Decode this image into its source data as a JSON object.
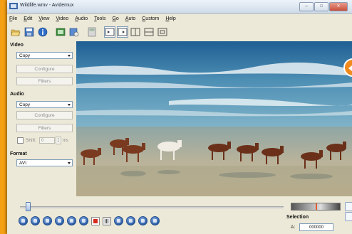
{
  "window": {
    "title": "Wildlife.wmv - Avidemux"
  },
  "menu": [
    "File",
    "Edit",
    "View",
    "Video",
    "Audio",
    "Tools",
    "Go",
    "Auto",
    "Custom",
    "Help"
  ],
  "sidebar": {
    "video": {
      "title": "Video",
      "codec": "Copy",
      "configure_label": "Configure",
      "filters_label": "Filters"
    },
    "audio": {
      "title": "Audio",
      "codec": "Copy",
      "configure_label": "Configure",
      "filters_label": "Filters",
      "shift_label": "Shift:",
      "shift_value": "0",
      "shift_unit": "ms"
    },
    "format": {
      "title": "Format",
      "container": "AVI"
    }
  },
  "selection": {
    "title": "Selection",
    "a_label": "A:",
    "a_value": "000000"
  },
  "playback": {
    "position": 0.03
  },
  "colors": {
    "accent_orange": "#f08a1d",
    "background_orange": "#f5a014",
    "window_bg": "#ece9d8"
  },
  "icons": {
    "toolbar": [
      "open-icon",
      "save-icon",
      "info-icon",
      "film-icon",
      "save-video-icon",
      "calculator-icon",
      "input-view-icon",
      "output-view-icon",
      "side-view-icon",
      "top-bottom-view-icon",
      "separate-view-icon"
    ],
    "controls": [
      "play-icon",
      "stop-icon",
      "previous-frame-icon",
      "next-frame-icon",
      "previous-keyframe-icon",
      "next-keyframe-icon",
      "record-icon",
      "mark-icon",
      "set-marker-a-icon",
      "set-marker-b-icon",
      "first-frame-icon",
      "last-frame-icon"
    ]
  }
}
